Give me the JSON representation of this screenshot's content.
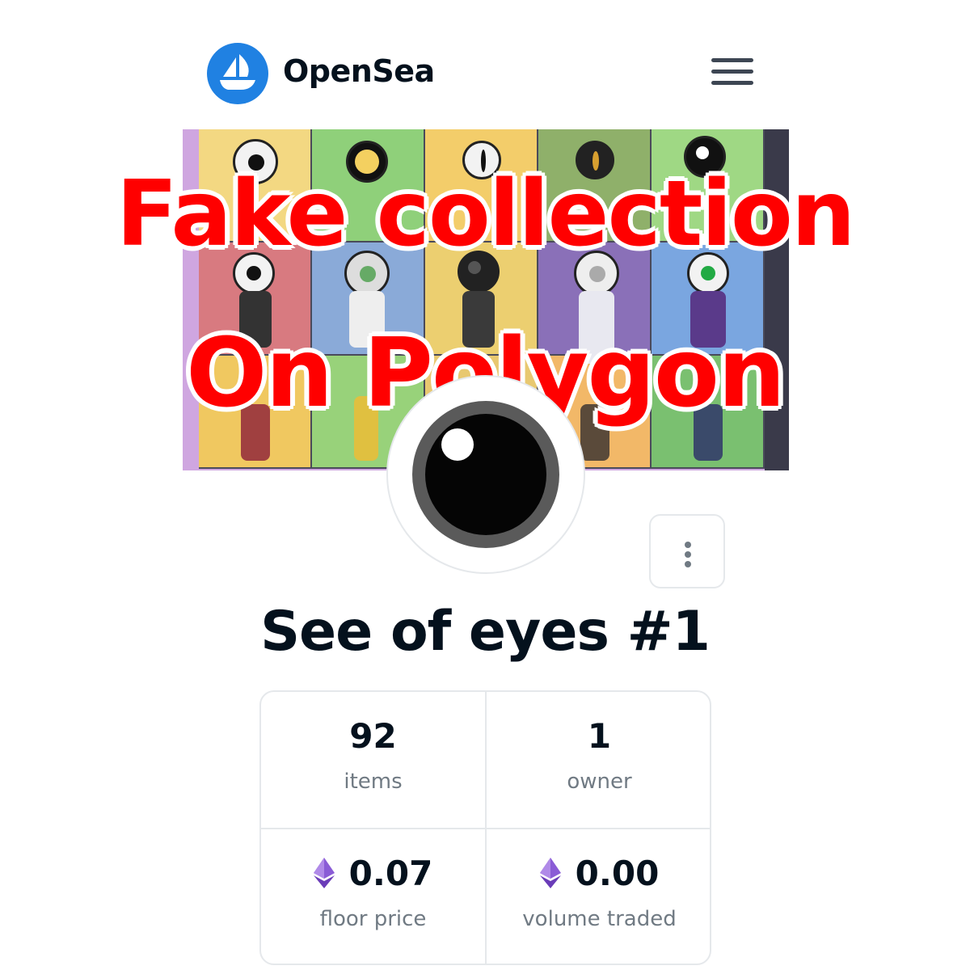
{
  "header": {
    "brand": "OpenSea",
    "logo_icon": "opensea-ship-icon",
    "menu_icon": "hamburger-menu-icon",
    "accent": "#2081e2"
  },
  "overlay": {
    "line1": "Fake collection",
    "line2": "On Polygon",
    "color": "#ff0000"
  },
  "collection": {
    "name": "See of eyes #1",
    "more_icon": "more-vertical-icon"
  },
  "stats": [
    {
      "value": "92",
      "label": "items",
      "icon": ""
    },
    {
      "value": "1",
      "label": "owner",
      "icon": ""
    },
    {
      "value": "0.07",
      "label": "floor price",
      "icon": "eth-icon"
    },
    {
      "value": "0.00",
      "label": "volume traded",
      "icon": "eth-icon"
    }
  ],
  "colors": {
    "eth": "#8a5cd6",
    "muted_text": "#707a83"
  }
}
